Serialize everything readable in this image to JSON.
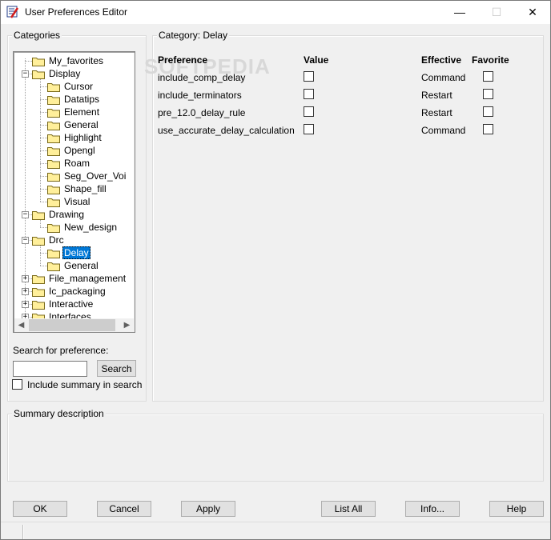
{
  "window": {
    "title": "User Preferences Editor",
    "minimize_glyph": "—",
    "maximize_glyph": "☐",
    "close_glyph": "✕"
  },
  "categories_panel": {
    "group_title": "Categories",
    "tree": [
      {
        "label": "My_favorites",
        "level": 0,
        "expander": "",
        "selected": false
      },
      {
        "label": "Display",
        "level": 0,
        "expander": "−",
        "selected": false
      },
      {
        "label": "Cursor",
        "level": 1,
        "expander": "",
        "selected": false
      },
      {
        "label": "Datatips",
        "level": 1,
        "expander": "",
        "selected": false
      },
      {
        "label": "Element",
        "level": 1,
        "expander": "",
        "selected": false
      },
      {
        "label": "General",
        "level": 1,
        "expander": "",
        "selected": false
      },
      {
        "label": "Highlight",
        "level": 1,
        "expander": "",
        "selected": false
      },
      {
        "label": "Opengl",
        "level": 1,
        "expander": "",
        "selected": false
      },
      {
        "label": "Roam",
        "level": 1,
        "expander": "",
        "selected": false
      },
      {
        "label": "Seg_Over_Voi",
        "level": 1,
        "expander": "",
        "selected": false
      },
      {
        "label": "Shape_fill",
        "level": 1,
        "expander": "",
        "selected": false
      },
      {
        "label": "Visual",
        "level": 1,
        "expander": "",
        "selected": false
      },
      {
        "label": "Drawing",
        "level": 0,
        "expander": "−",
        "selected": false
      },
      {
        "label": "New_design",
        "level": 1,
        "expander": "",
        "selected": false
      },
      {
        "label": "Drc",
        "level": 0,
        "expander": "−",
        "selected": false
      },
      {
        "label": "Delay",
        "level": 1,
        "expander": "",
        "selected": true
      },
      {
        "label": "General",
        "level": 1,
        "expander": "",
        "selected": false
      },
      {
        "label": "File_management",
        "level": 0,
        "expander": "+",
        "selected": false
      },
      {
        "label": "Ic_packaging",
        "level": 0,
        "expander": "+",
        "selected": false
      },
      {
        "label": "Interactive",
        "level": 0,
        "expander": "+",
        "selected": false
      },
      {
        "label": "Interfaces",
        "level": 0,
        "expander": "+",
        "selected": false
      }
    ],
    "search_label": "Search for preference:",
    "search_value": "",
    "search_button": "Search",
    "include_summary_label": "Include summary in search",
    "include_summary_checked": false
  },
  "category_panel": {
    "group_title": "Category:  Delay",
    "columns": {
      "preference": "Preference",
      "value": "Value",
      "effective": "Effective",
      "favorite": "Favorite"
    },
    "rows": [
      {
        "preference": "include_comp_delay",
        "value_checked": false,
        "effective": "Command",
        "favorite_checked": false
      },
      {
        "preference": "include_terminators",
        "value_checked": false,
        "effective": "Restart",
        "favorite_checked": false
      },
      {
        "preference": "pre_12.0_delay_rule",
        "value_checked": false,
        "effective": "Restart",
        "favorite_checked": false
      },
      {
        "preference": "use_accurate_delay_calculation",
        "value_checked": false,
        "effective": "Command",
        "favorite_checked": false
      }
    ]
  },
  "summary": {
    "group_title": "Summary description",
    "text": ""
  },
  "buttons": {
    "ok": "OK",
    "cancel": "Cancel",
    "apply": "Apply",
    "list_all": "List All",
    "info": "Info...",
    "help": "Help"
  },
  "watermark": "SOFTPEDIA",
  "colors": {
    "selection": "#0078d7",
    "folder": "#ffef9a"
  }
}
